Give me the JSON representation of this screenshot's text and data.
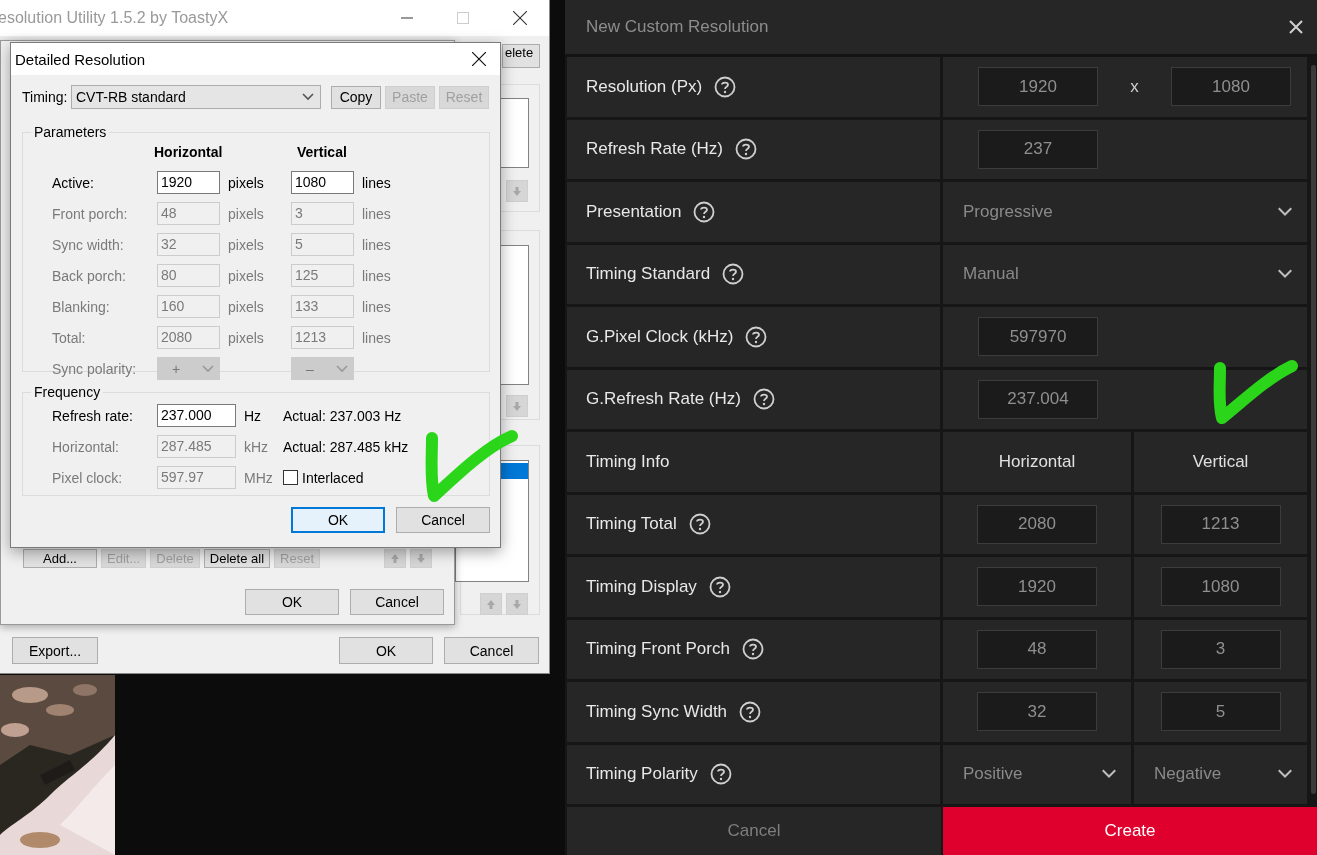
{
  "main_window": {
    "title": "esolution Utility 1.5.2 by ToastyX",
    "covered_button": "elete",
    "list_boxes": [
      {
        "highlighted_row": false
      },
      {
        "highlighted_row": false
      },
      {
        "highlighted_row": true
      }
    ],
    "buttons": [
      {
        "label": "Export..."
      },
      {
        "label": "OK"
      },
      {
        "label": "Cancel"
      }
    ]
  },
  "inner_window": {
    "buttons": [
      {
        "label": "Add...",
        "disabled": false
      },
      {
        "label": "Edit...",
        "disabled": true
      },
      {
        "label": "Delete",
        "disabled": true
      },
      {
        "label": "Delete all",
        "disabled": false
      },
      {
        "label": "Reset",
        "disabled": true
      }
    ],
    "dialog_buttons": [
      {
        "label": "OK"
      },
      {
        "label": "Cancel"
      }
    ]
  },
  "dialog": {
    "title": "Detailed Resolution",
    "timing_label": "Timing:",
    "timing_value": "CVT-RB standard",
    "timing_buttons": [
      {
        "label": "Copy",
        "disabled": false
      },
      {
        "label": "Paste",
        "disabled": true
      },
      {
        "label": "Reset",
        "disabled": true
      }
    ],
    "parameters": {
      "title": "Parameters",
      "headers": [
        "Horizontal",
        "Vertical"
      ],
      "rows": [
        {
          "kind": "field",
          "label": "Active:",
          "disabled": false,
          "h": "1920",
          "h_unit": "pixels",
          "v": "1080",
          "v_unit": "lines"
        },
        {
          "kind": "field",
          "label": "Front porch:",
          "disabled": true,
          "h": "48",
          "h_unit": "pixels",
          "v": "3",
          "v_unit": "lines"
        },
        {
          "kind": "field",
          "label": "Sync width:",
          "disabled": true,
          "h": "32",
          "h_unit": "pixels",
          "v": "5",
          "v_unit": "lines"
        },
        {
          "kind": "field",
          "label": "Back porch:",
          "disabled": true,
          "h": "80",
          "h_unit": "pixels",
          "v": "125",
          "v_unit": "lines"
        },
        {
          "kind": "field",
          "label": "Blanking:",
          "disabled": true,
          "h": "160",
          "h_unit": "pixels",
          "v": "133",
          "v_unit": "lines"
        },
        {
          "kind": "field",
          "label": "Total:",
          "disabled": true,
          "h": "2080",
          "h_unit": "pixels",
          "v": "1213",
          "v_unit": "lines"
        },
        {
          "kind": "select",
          "label": "Sync polarity:",
          "disabled": true,
          "h": "+",
          "v": "–"
        }
      ]
    },
    "frequency": {
      "title": "Frequency",
      "rows": [
        {
          "label": "Refresh rate:",
          "disabled": false,
          "value": "237.000",
          "unit": "Hz",
          "extra": {
            "kind": "text",
            "text": "Actual: 237.003 Hz"
          }
        },
        {
          "label": "Horizontal:",
          "disabled": true,
          "value": "287.485",
          "unit": "kHz",
          "extra": {
            "kind": "text",
            "text": "Actual: 287.485 kHz"
          }
        },
        {
          "label": "Pixel clock:",
          "disabled": true,
          "value": "597.97",
          "unit": "MHz",
          "extra": {
            "kind": "checkbox",
            "text": "Interlaced",
            "checked": false
          }
        }
      ]
    },
    "buttons": [
      {
        "label": "OK",
        "default": true
      },
      {
        "label": "Cancel",
        "default": false
      }
    ]
  },
  "panel": {
    "title": "New Custom Resolution",
    "rows": [
      {
        "label": "Resolution (Px)",
        "help": true,
        "kind": "pair",
        "values": [
          "1920",
          "1080"
        ],
        "separator": "x"
      },
      {
        "label": "Refresh Rate (Hz)",
        "help": true,
        "kind": "single",
        "values": [
          "237"
        ]
      },
      {
        "label": "Presentation",
        "help": true,
        "kind": "select",
        "values": [
          "Progressive"
        ]
      },
      {
        "label": "Timing Standard",
        "help": true,
        "kind": "select",
        "values": [
          "Manual"
        ]
      },
      {
        "label": "G.Pixel Clock (kHz)",
        "help": true,
        "kind": "single",
        "values": [
          "597970"
        ]
      },
      {
        "label": "G.Refresh Rate (Hz)",
        "help": true,
        "kind": "single",
        "values": [
          "237.004"
        ]
      },
      {
        "label": "Timing Info",
        "help": false,
        "kind": "header",
        "values": [
          "Horizontal",
          "Vertical"
        ]
      },
      {
        "label": "Timing Total",
        "help": true,
        "kind": "split",
        "values": [
          "2080",
          "1213"
        ]
      },
      {
        "label": "Timing Display",
        "help": true,
        "kind": "split",
        "values": [
          "1920",
          "1080"
        ]
      },
      {
        "label": "Timing Front Porch",
        "help": true,
        "kind": "split",
        "values": [
          "48",
          "3"
        ]
      },
      {
        "label": "Timing Sync Width",
        "help": true,
        "kind": "split",
        "values": [
          "32",
          "5"
        ]
      },
      {
        "label": "Timing Polarity",
        "help": true,
        "kind": "select-split",
        "values": [
          "Positive",
          "Negative"
        ]
      }
    ],
    "buttons": [
      {
        "label": "Cancel",
        "primary": false
      },
      {
        "label": "Create",
        "primary": true
      }
    ]
  }
}
